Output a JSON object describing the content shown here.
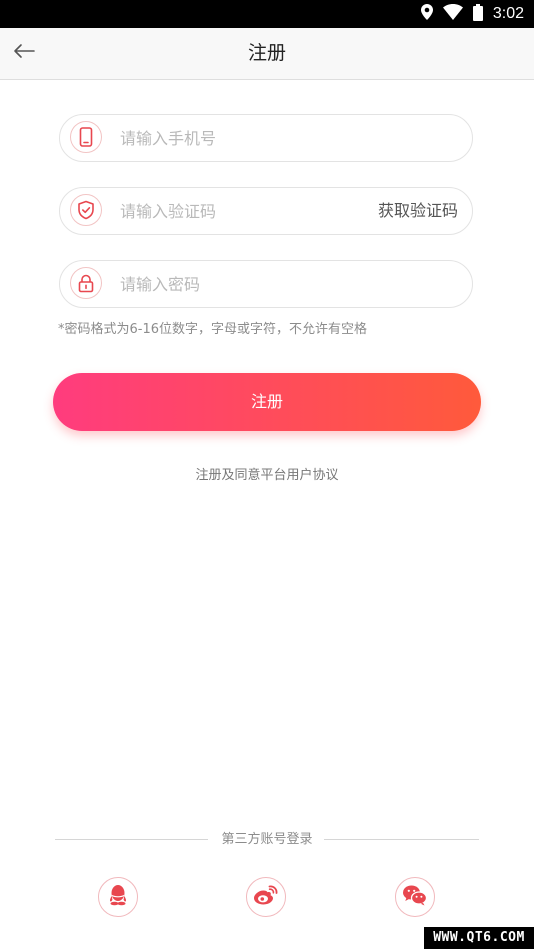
{
  "status_bar": {
    "time": "3:02",
    "icons": [
      "location-icon",
      "wifi-icon",
      "battery-icon"
    ]
  },
  "header": {
    "back_icon": "back-arrow-icon",
    "title": "注册"
  },
  "form": {
    "phone": {
      "icon": "phone-icon",
      "placeholder": "请输入手机号",
      "value": ""
    },
    "code": {
      "icon": "shield-icon",
      "placeholder": "请输入验证码",
      "value": "",
      "get_code_label": "获取验证码"
    },
    "password": {
      "icon": "lock-icon",
      "placeholder": "请输入密码",
      "value": ""
    },
    "hint": "*密码格式为6-16位数字，字母或字符，不允许有空格",
    "register_label": "注册",
    "agreement": "注册及同意平台用户协议"
  },
  "third_party": {
    "label": "第三方账号登录",
    "providers": [
      {
        "name": "qq",
        "icon": "qq-icon"
      },
      {
        "name": "weibo",
        "icon": "weibo-icon"
      },
      {
        "name": "wechat",
        "icon": "wechat-icon"
      }
    ]
  },
  "colors": {
    "accent_start": "#ff3c7e",
    "accent_end": "#ff5a3b",
    "icon_red": "#e8474f"
  },
  "watermark": "WWW.QT6.COM"
}
